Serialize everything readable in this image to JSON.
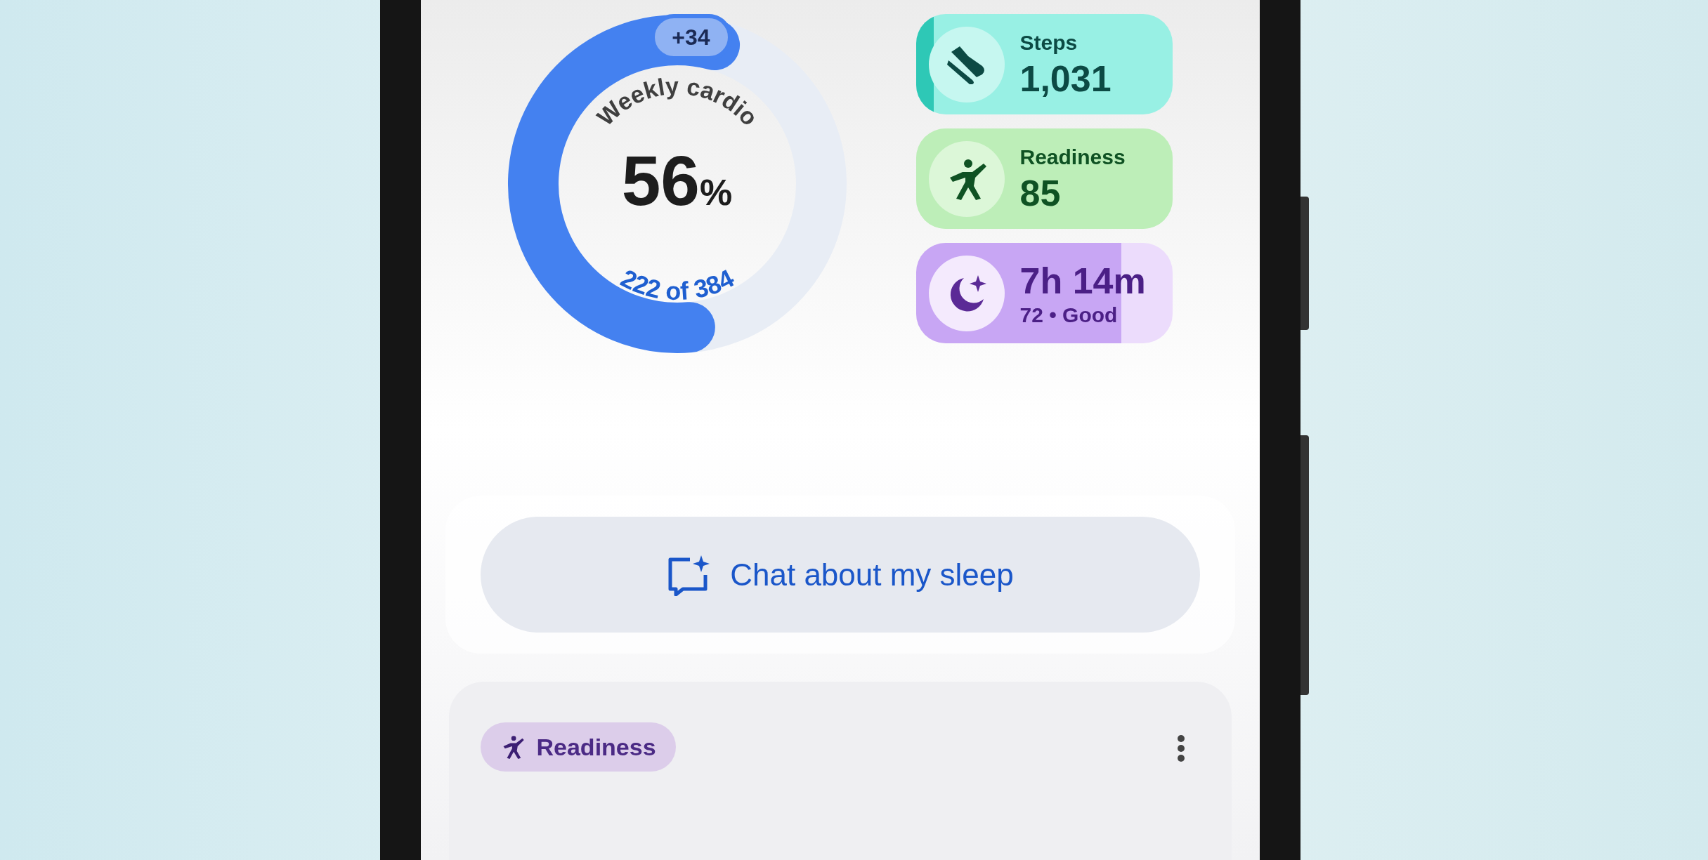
{
  "ring": {
    "badge": "+34",
    "title": "Weekly cardio",
    "value": "56",
    "unit": "%",
    "progress": "222 of 384"
  },
  "stats": [
    {
      "kind": "steps",
      "label": "Steps",
      "value": "1,031",
      "level": 0.07
    },
    {
      "kind": "readiness",
      "label": "Readiness",
      "value": "85",
      "level": 1
    },
    {
      "kind": "sleep",
      "value": "7h 14m",
      "detail": "72 • Good",
      "level": 0.8
    }
  ],
  "chat_button": {
    "label": "Chat about my sleep"
  },
  "insight_card": {
    "tag": "Readiness"
  }
}
